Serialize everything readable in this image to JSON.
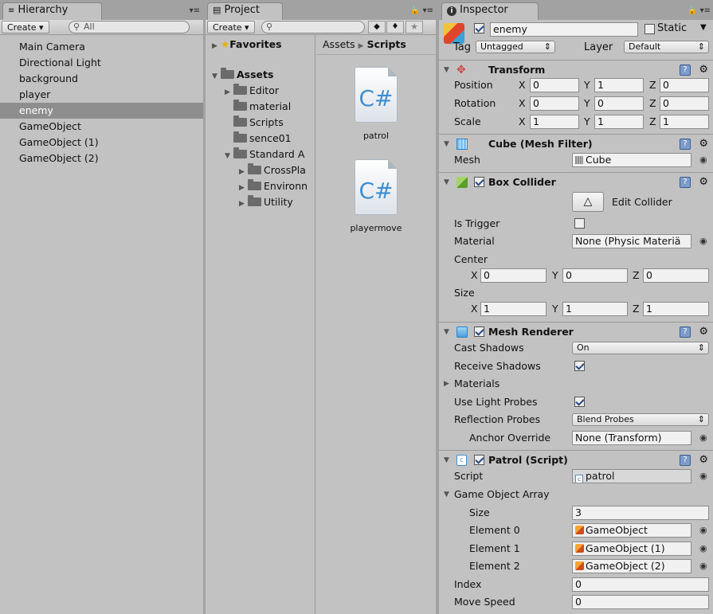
{
  "hierarchy": {
    "tab": "Hierarchy",
    "create": "Create",
    "search_placeholder": "All",
    "items": [
      "Main Camera",
      "Directional Light",
      "background",
      "player",
      "enemy",
      "GameObject",
      "GameObject (1)",
      "GameObject (2)"
    ],
    "selected": "enemy"
  },
  "project": {
    "tab": "Project",
    "create": "Create",
    "favorites": "Favorites",
    "assets": "Assets",
    "breadcrumb": {
      "root": "Assets",
      "current": "Scripts"
    },
    "tree": [
      "Editor",
      "material",
      "Scripts",
      "sence01",
      "Standard A",
      "CrossPla",
      "Environn",
      "Utility"
    ],
    "files": [
      {
        "name": "patrol",
        "icon": "C#"
      },
      {
        "name": "playermove",
        "icon": "C#"
      }
    ]
  },
  "inspector": {
    "tab": "Inspector",
    "object_name": "enemy",
    "static_label": "Static",
    "tag_label": "Tag",
    "tag_value": "Untagged",
    "layer_label": "Layer",
    "layer_value": "Default",
    "transform": {
      "title": "Transform",
      "rows": [
        {
          "label": "Position",
          "x": "0",
          "y": "1",
          "z": "0"
        },
        {
          "label": "Rotation",
          "x": "0",
          "y": "0",
          "z": "0"
        },
        {
          "label": "Scale",
          "x": "1",
          "y": "1",
          "z": "1"
        }
      ]
    },
    "mesh_filter": {
      "title": "Cube (Mesh Filter)",
      "mesh_label": "Mesh",
      "mesh_value": "Cube"
    },
    "box_collider": {
      "title": "Box Collider",
      "edit_label": "Edit Collider",
      "is_trigger_label": "Is Trigger",
      "material_label": "Material",
      "material_value": "None (Physic Materiä",
      "center_label": "Center",
      "center": {
        "x": "0",
        "y": "0",
        "z": "0"
      },
      "size_label": "Size",
      "size": {
        "x": "1",
        "y": "1",
        "z": "1"
      }
    },
    "mesh_renderer": {
      "title": "Mesh Renderer",
      "cast_shadows_label": "Cast Shadows",
      "cast_shadows_value": "On",
      "receive_shadows_label": "Receive Shadows",
      "materials_label": "Materials",
      "light_probes_label": "Use Light Probes",
      "reflection_label": "Reflection Probes",
      "reflection_value": "Blend Probes",
      "anchor_label": "Anchor Override",
      "anchor_value": "None (Transform)"
    },
    "patrol": {
      "title": "Patrol (Script)",
      "script_label": "Script",
      "script_value": "patrol",
      "array_label": "Game Object Array",
      "size_label": "Size",
      "size_value": "3",
      "elements": [
        {
          "label": "Element 0",
          "value": "GameObject"
        },
        {
          "label": "Element 1",
          "value": "GameObject (1)"
        },
        {
          "label": "Element 2",
          "value": "GameObject (2)"
        }
      ],
      "index_label": "Index",
      "index_value": "0",
      "speed_label": "Move Speed",
      "speed_value": "0"
    }
  }
}
